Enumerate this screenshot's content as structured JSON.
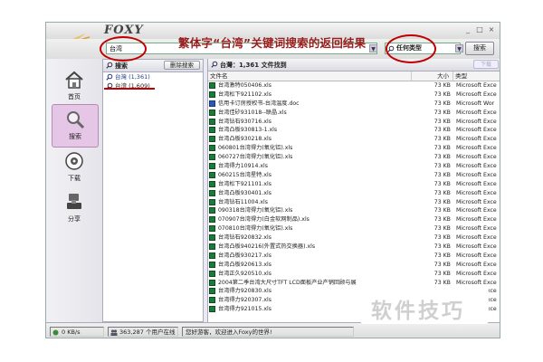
{
  "app": {
    "logo": "FOXY",
    "window_buttons": [
      "_",
      "□",
      "×"
    ]
  },
  "search": {
    "value": "台湾",
    "type_value": "任何类型",
    "go_label": "搜索"
  },
  "annotation": "繁体字“台湾”关键词搜索的返回结果",
  "sidebar": {
    "items": [
      {
        "label": "首页",
        "icon": "home-icon"
      },
      {
        "label": "搜索",
        "icon": "search-icon"
      },
      {
        "label": "下载",
        "icon": "download-icon"
      },
      {
        "label": "分享",
        "icon": "share-icon"
      }
    ]
  },
  "results_panel": {
    "title": "搜索",
    "delete_label": "删除搜索",
    "results": [
      "台灣 (1,361)",
      "台湾 (1,609)"
    ]
  },
  "main": {
    "title": "台灣：1,361 文件找到",
    "download_label": "下载",
    "columns": {
      "name": "文件名",
      "size": "大小",
      "type": "类型"
    },
    "files": [
      {
        "name": "台湾激特050406.xls",
        "size": "73 KB",
        "type": "Microsoft Exce"
      },
      {
        "name": "台湾松下921102.xls",
        "size": "73 KB",
        "type": "Microsoft Exce"
      },
      {
        "name": "信用卡订房授权书-台湾温度.doc",
        "size": "73 KB",
        "type": "Microsoft Wor"
      },
      {
        "name": "台湾佳矽931018--联晶.xls",
        "size": "73 KB",
        "type": "Microsoft Exce"
      },
      {
        "name": "台湾钻石930716.xls",
        "size": "73 KB",
        "type": "Microsoft Exce"
      },
      {
        "name": "台湾凸板930813-1.xls",
        "size": "73 KB",
        "type": "Microsoft Exce"
      },
      {
        "name": "台湾凸板930218.xls",
        "size": "73 KB",
        "type": "Microsoft Exce"
      },
      {
        "name": "060801台湾得力(氧化铝).xls",
        "size": "73 KB",
        "type": "Microsoft Exce"
      },
      {
        "name": "060727台湾得力(氧化铝).xls",
        "size": "73 KB",
        "type": "Microsoft Exce"
      },
      {
        "name": "台湾得力10914.xls",
        "size": "73 KB",
        "type": "Microsoft Exce"
      },
      {
        "name": "060215台湾星特.xls",
        "size": "73 KB",
        "type": "Microsoft Exce"
      },
      {
        "name": "台湾松下921101.xls",
        "size": "73 KB",
        "type": "Microsoft Exce"
      },
      {
        "name": "台湾凸板930401.xls",
        "size": "73 KB",
        "type": "Microsoft Exce"
      },
      {
        "name": "台湾钻石11004.xls",
        "size": "73 KB",
        "type": "Microsoft Exce"
      },
      {
        "name": "090318台湾得力(氧化铝).xls",
        "size": "73 KB",
        "type": "Microsoft Exce"
      },
      {
        "name": "070907台湾得力(白金软网制品).xls",
        "size": "73 KB",
        "type": "Microsoft Exce"
      },
      {
        "name": "070810台湾得力(氧化铝).xls",
        "size": "73 KB",
        "type": "Microsoft Exce"
      },
      {
        "name": "台湾钻石920832.xls",
        "size": "73 KB",
        "type": "Microsoft Exce"
      },
      {
        "name": "台湾凸板940216(外置式热交换器).xls",
        "size": "73 KB",
        "type": "Microsoft Exce"
      },
      {
        "name": "台湾凸板930217.xls",
        "size": "73 KB",
        "type": "Microsoft Exce"
      },
      {
        "name": "台湾凸板920613.xls",
        "size": "73 KB",
        "type": "Microsoft Exce"
      },
      {
        "name": "台湾正久920510.xls",
        "size": "73 KB",
        "type": "Microsoft Exce"
      },
      {
        "name": "2004第二季台湾大尺寸TFT LCD面板产业产销回顾与展",
        "size": "73 KB",
        "type": "Microsoft Exce"
      },
      {
        "name": "台湾得力920830.xls",
        "size": "73 KB",
        "type": "Microsoft Exce"
      },
      {
        "name": "台湾得力920307.xls",
        "size": "73 KB",
        "type": "Microsoft Exce"
      },
      {
        "name": "台湾得力921015.xls",
        "size": "73 KB",
        "type": "Microsoft Exce"
      }
    ]
  },
  "status": {
    "speed": "0 KB/s",
    "users": "363,287 个用户在线",
    "welcome": "您好游客，欢迎进入Foxy的世界!"
  },
  "watermark": "软件技巧",
  "colors": {
    "annotation": "#9b1d1d",
    "circle": "#c00000",
    "active_nav": "#e6c6e6"
  }
}
